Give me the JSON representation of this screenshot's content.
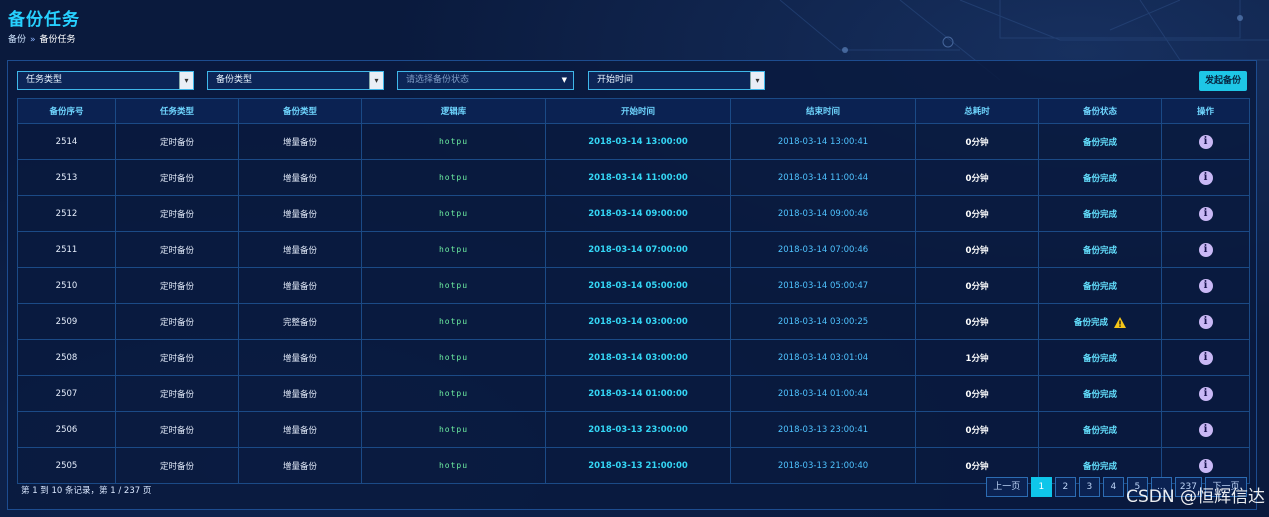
{
  "header": {
    "title": "备份任务"
  },
  "breadcrumb": {
    "root": "备份",
    "separator": "»",
    "current": "备份任务"
  },
  "filters": {
    "task_type": "任务类型",
    "backup_type": "备份类型",
    "backup_status_placeholder": "请选择备份状态",
    "start_time": "开始时间"
  },
  "toolbar": {
    "start_backup_label": "发起备份"
  },
  "table": {
    "columns": [
      "备份序号",
      "任务类型",
      "备份类型",
      "逻辑库",
      "开始时间",
      "结束时间",
      "总耗时",
      "备份状态",
      "操作"
    ],
    "rows": [
      {
        "id": "2514",
        "task": "定时备份",
        "type": "增量备份",
        "db": "hotpu",
        "start": "2018-03-14 13:00:00",
        "end": "2018-03-14 13:00:41",
        "dur": "0分钟",
        "status": "备份完成",
        "warn": false
      },
      {
        "id": "2513",
        "task": "定时备份",
        "type": "增量备份",
        "db": "hotpu",
        "start": "2018-03-14 11:00:00",
        "end": "2018-03-14 11:00:44",
        "dur": "0分钟",
        "status": "备份完成",
        "warn": false
      },
      {
        "id": "2512",
        "task": "定时备份",
        "type": "增量备份",
        "db": "hotpu",
        "start": "2018-03-14 09:00:00",
        "end": "2018-03-14 09:00:46",
        "dur": "0分钟",
        "status": "备份完成",
        "warn": false
      },
      {
        "id": "2511",
        "task": "定时备份",
        "type": "增量备份",
        "db": "hotpu",
        "start": "2018-03-14 07:00:00",
        "end": "2018-03-14 07:00:46",
        "dur": "0分钟",
        "status": "备份完成",
        "warn": false
      },
      {
        "id": "2510",
        "task": "定时备份",
        "type": "增量备份",
        "db": "hotpu",
        "start": "2018-03-14 05:00:00",
        "end": "2018-03-14 05:00:47",
        "dur": "0分钟",
        "status": "备份完成",
        "warn": false
      },
      {
        "id": "2509",
        "task": "定时备份",
        "type": "完整备份",
        "db": "hotpu",
        "start": "2018-03-14 03:00:00",
        "end": "2018-03-14 03:00:25",
        "dur": "0分钟",
        "status": "备份完成",
        "warn": true
      },
      {
        "id": "2508",
        "task": "定时备份",
        "type": "增量备份",
        "db": "hotpu",
        "start": "2018-03-14 03:00:00",
        "end": "2018-03-14 03:01:04",
        "dur": "1分钟",
        "status": "备份完成",
        "warn": false
      },
      {
        "id": "2507",
        "task": "定时备份",
        "type": "增量备份",
        "db": "hotpu",
        "start": "2018-03-14 01:00:00",
        "end": "2018-03-14 01:00:44",
        "dur": "0分钟",
        "status": "备份完成",
        "warn": false
      },
      {
        "id": "2506",
        "task": "定时备份",
        "type": "增量备份",
        "db": "hotpu",
        "start": "2018-03-13 23:00:00",
        "end": "2018-03-13 23:00:41",
        "dur": "0分钟",
        "status": "备份完成",
        "warn": false
      },
      {
        "id": "2505",
        "task": "定时备份",
        "type": "增量备份",
        "db": "hotpu",
        "start": "2018-03-13 21:00:00",
        "end": "2018-03-13 21:00:40",
        "dur": "0分钟",
        "status": "备份完成",
        "warn": false
      }
    ]
  },
  "pagination": {
    "summary": "第 1 到 10 条记录，第 1 / 237 页",
    "prev": "上一页",
    "pages": [
      "1",
      "2",
      "3",
      "4",
      "5",
      "...",
      "237"
    ],
    "next": "下一页",
    "active": "1"
  },
  "watermark": "CSDN @恒辉信达",
  "icons": {
    "info": "info-icon",
    "warning": "warning-icon",
    "dropdown": "chevron-down-icon"
  },
  "colors": {
    "accent": "#1ec6e6",
    "title": "#27d1ff",
    "db_text": "#6ef0a2",
    "warning": "#f5c518"
  }
}
